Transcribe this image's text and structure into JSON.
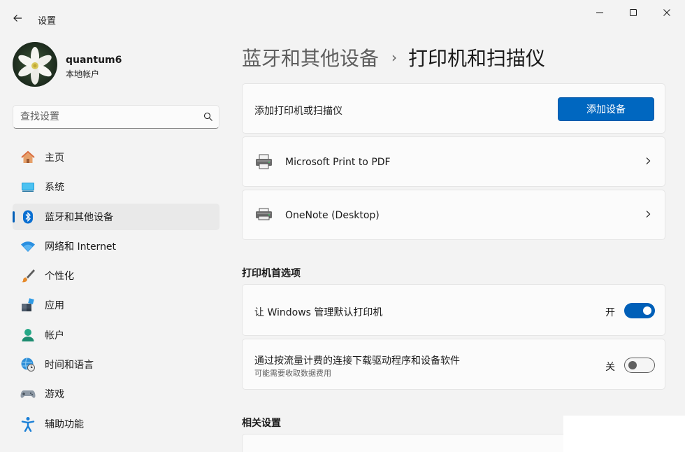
{
  "window": {
    "title": "设置"
  },
  "profile": {
    "name": "quantum6",
    "account_type": "本地帐户"
  },
  "search": {
    "placeholder": "查找设置"
  },
  "nav": {
    "items": [
      {
        "label": "主页",
        "icon": "home-icon"
      },
      {
        "label": "系统",
        "icon": "system-icon"
      },
      {
        "label": "蓝牙和其他设备",
        "icon": "bluetooth-icon",
        "selected": true
      },
      {
        "label": "网络和 Internet",
        "icon": "wifi-icon"
      },
      {
        "label": "个性化",
        "icon": "brush-icon"
      },
      {
        "label": "应用",
        "icon": "apps-icon"
      },
      {
        "label": "帐户",
        "icon": "person-icon"
      },
      {
        "label": "时间和语言",
        "icon": "globe-clock-icon"
      },
      {
        "label": "游戏",
        "icon": "gamepad-icon"
      },
      {
        "label": "辅助功能",
        "icon": "accessibility-icon"
      }
    ]
  },
  "breadcrumb": {
    "parent": "蓝牙和其他设备",
    "separator": "›",
    "current": "打印机和扫描仪"
  },
  "add_printer": {
    "label": "添加打印机或扫描仪",
    "button_label": "添加设备"
  },
  "printers": [
    {
      "name": "Microsoft Print to PDF",
      "icon": "printer-icon"
    },
    {
      "name": "OneNote (Desktop)",
      "icon": "printer-icon"
    }
  ],
  "preferences": {
    "title": "打印机首选项",
    "items": [
      {
        "label": "让 Windows 管理默认打印机",
        "state_label": "开",
        "on": true
      },
      {
        "label": "通过按流量计费的连接下载驱动程序和设备软件",
        "sublabel": "可能需要收取数据费用",
        "state_label": "关",
        "on": false
      }
    ]
  },
  "related": {
    "title": "相关设置"
  },
  "colors": {
    "accent": "#005fb8",
    "button": "#0067c0",
    "background": "#f3f3f3",
    "card": "#fbfbfb"
  }
}
